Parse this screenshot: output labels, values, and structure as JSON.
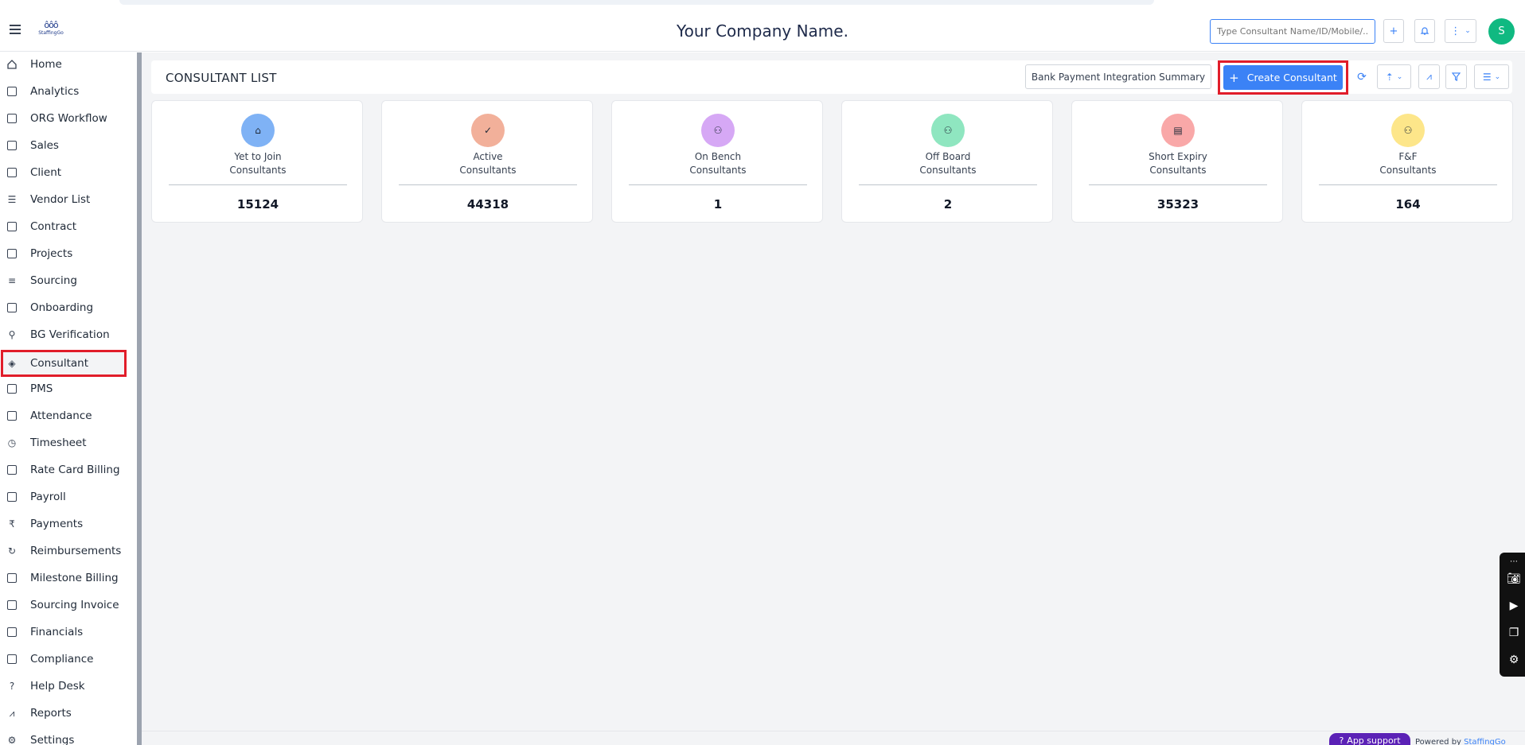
{
  "header": {
    "company_name": "Your Company Name.",
    "logo_text": "StaffingGo",
    "search_placeholder": "Type Consultant Name/ID/Mobile/...",
    "avatar_initial": "S"
  },
  "sidebar": {
    "items": [
      {
        "label": "Home",
        "icon": "home-icon"
      },
      {
        "label": "Analytics",
        "icon": "analytics-icon"
      },
      {
        "label": "ORG Workflow",
        "icon": "workflow-icon"
      },
      {
        "label": "Sales",
        "icon": "sales-icon"
      },
      {
        "label": "Client",
        "icon": "client-icon"
      },
      {
        "label": "Vendor List",
        "icon": "vendor-list-icon"
      },
      {
        "label": "Contract",
        "icon": "contract-icon"
      },
      {
        "label": "Projects",
        "icon": "projects-icon"
      },
      {
        "label": "Sourcing",
        "icon": "sourcing-icon"
      },
      {
        "label": "Onboarding",
        "icon": "onboarding-icon"
      },
      {
        "label": "BG Verification",
        "icon": "bg-verification-icon"
      },
      {
        "label": "Consultant",
        "icon": "consultant-icon"
      },
      {
        "label": "PMS",
        "icon": "pms-icon"
      },
      {
        "label": "Attendance",
        "icon": "calendar-icon"
      },
      {
        "label": "Timesheet",
        "icon": "clock-icon"
      },
      {
        "label": "Rate Card Billing",
        "icon": "rate-card-icon"
      },
      {
        "label": "Payroll",
        "icon": "payroll-icon"
      },
      {
        "label": "Payments",
        "icon": "rupee-icon"
      },
      {
        "label": "Reimbursements",
        "icon": "reimbursement-icon"
      },
      {
        "label": "Milestone Billing",
        "icon": "milestone-icon"
      },
      {
        "label": "Sourcing Invoice",
        "icon": "invoice-icon"
      },
      {
        "label": "Financials",
        "icon": "financials-icon"
      },
      {
        "label": "Compliance",
        "icon": "compliance-icon"
      },
      {
        "label": "Help Desk",
        "icon": "help-icon"
      },
      {
        "label": "Reports",
        "icon": "reports-icon"
      },
      {
        "label": "Settings",
        "icon": "settings-icon"
      }
    ],
    "active": "Consultant"
  },
  "main": {
    "title": "CONSULTANT LIST",
    "bank_button": "Bank Payment Integration Summary",
    "create_button": "Create Consultant"
  },
  "cards": [
    {
      "line1": "Yet to Join",
      "line2": "Consultants",
      "value": "15124",
      "color": "#7fb2f5"
    },
    {
      "line1": "Active",
      "line2": "Consultants",
      "value": "44318",
      "color": "#f2b09a"
    },
    {
      "line1": "On Bench",
      "line2": "Consultants",
      "value": "1",
      "color": "#d6a8f5"
    },
    {
      "line1": "Off Board",
      "line2": "Consultants",
      "value": "2",
      "color": "#8fe6c0"
    },
    {
      "line1": "Short Expiry",
      "line2": "Consultants",
      "value": "35323",
      "color": "#f9a8a8"
    },
    {
      "line1": "F&F",
      "line2": "Consultants",
      "value": "164",
      "color": "#fde68a"
    }
  ],
  "footer": {
    "support": "App support",
    "powered_by": "Powered by",
    "powered_link": "StaffingGo"
  }
}
